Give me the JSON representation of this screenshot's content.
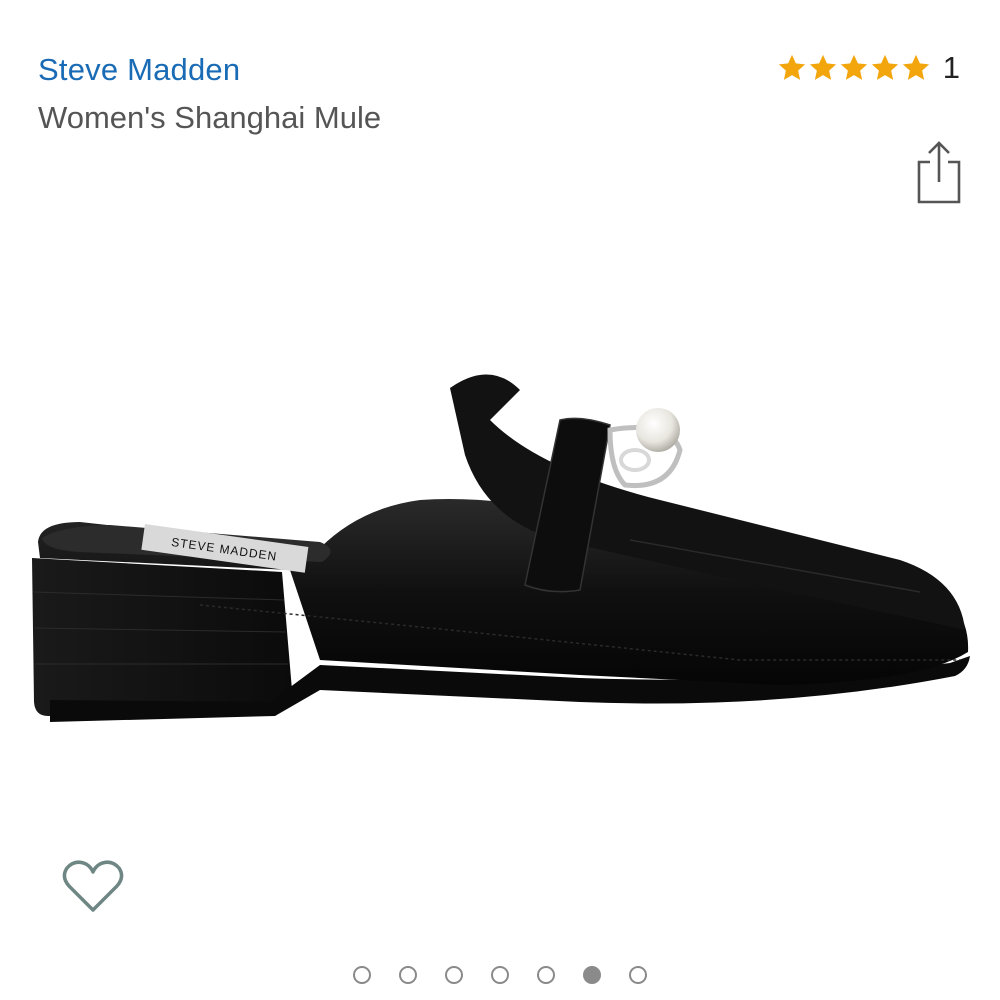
{
  "product": {
    "brand": "Steve Madden",
    "title": "Women's Shanghai Mule",
    "rating_stars": 5,
    "rating_count": "1",
    "star_color": "#f2a60c",
    "brand_color": "#1a6bb5"
  },
  "image": {
    "alt": "Black patent leather mule with pearl bit hardware",
    "insole_label": "STEVE MADDEN"
  },
  "carousel": {
    "total": 7,
    "active_index": 5
  },
  "icons": {
    "share": "share-icon",
    "wishlist": "heart-outline-icon"
  }
}
